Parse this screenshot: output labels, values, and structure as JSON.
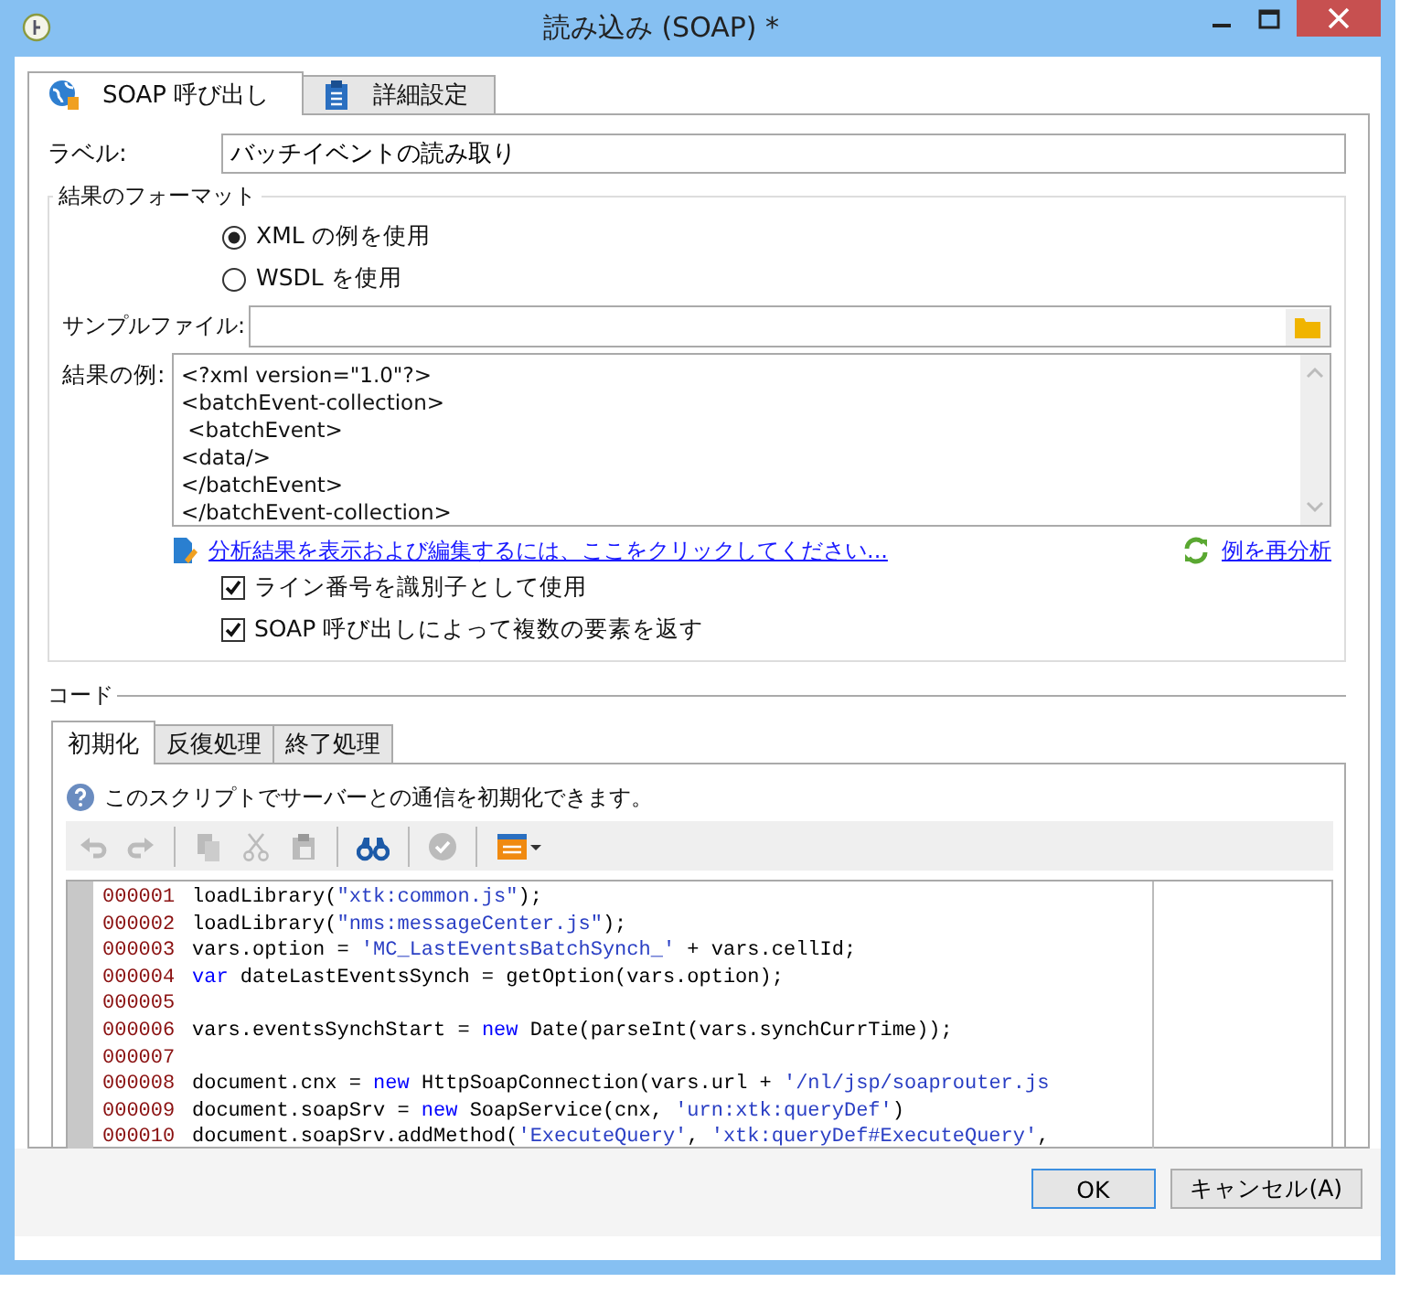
{
  "window": {
    "title": "読み込み (SOAP) *"
  },
  "tabs": [
    {
      "label": "SOAP 呼び出し",
      "selected": true
    },
    {
      "label": "詳細設定",
      "selected": false
    }
  ],
  "label_field": {
    "label": "ラベル:",
    "value": "バッチイベントの読み取り"
  },
  "result_format": {
    "title": "結果のフォーマット",
    "options": [
      {
        "label": "XML の例を使用",
        "selected": true
      },
      {
        "label": "WSDL を使用",
        "selected": false
      }
    ],
    "sample_file": {
      "label": "サンプルファイル:"
    },
    "example": {
      "label": "結果の例:",
      "lines": [
        "<?xml version=\"1.0\"?>",
        "<batchEvent-collection>",
        " <batchEvent>",
        "<data/>",
        "</batchEvent>",
        "</batchEvent-collection>"
      ]
    },
    "edit_link": "分析結果を表示および編集するには、ここをクリックしてください...",
    "reanalyze_link": "例を再分析",
    "checkboxes": [
      {
        "label": "ライン番号を識別子として使用",
        "checked": true
      },
      {
        "label": "SOAP 呼び出しによって複数の要素を返す",
        "checked": true
      }
    ]
  },
  "code": {
    "title": "コード",
    "tabs": [
      {
        "label": "初期化",
        "selected": true
      },
      {
        "label": "反復処理",
        "selected": false
      },
      {
        "label": "終了処理",
        "selected": false
      }
    ],
    "info": "このスクリプトでサーバーとの通信を初期化できます。",
    "toolbar": [
      {
        "kind": "undo",
        "disabled": true
      },
      {
        "kind": "redo",
        "disabled": true
      },
      {
        "kind": "sep"
      },
      {
        "kind": "copy",
        "disabled": true
      },
      {
        "kind": "cut",
        "disabled": true
      },
      {
        "kind": "paste",
        "disabled": true
      },
      {
        "kind": "sep"
      },
      {
        "kind": "find",
        "disabled": false
      },
      {
        "kind": "sep"
      },
      {
        "kind": "check",
        "disabled": true
      },
      {
        "kind": "sep"
      },
      {
        "kind": "insert",
        "disabled": false
      }
    ],
    "lines": [
      {
        "number": "000001",
        "tokens": [
          {
            "kind": "plain",
            "text": "loadLibrary("
          },
          {
            "kind": "string",
            "text": "\"xtk:common.js\""
          },
          {
            "kind": "plain",
            "text": ");"
          }
        ]
      },
      {
        "number": "000002",
        "tokens": [
          {
            "kind": "plain",
            "text": "loadLibrary("
          },
          {
            "kind": "string",
            "text": "\"nms:messageCenter.js\""
          },
          {
            "kind": "plain",
            "text": ");"
          }
        ]
      },
      {
        "number": "000003",
        "tokens": [
          {
            "kind": "plain",
            "text": "vars.option = "
          },
          {
            "kind": "string",
            "text": "'MC_LastEventsBatchSynch_'"
          },
          {
            "kind": "plain",
            "text": " + vars.cellId;"
          }
        ]
      },
      {
        "number": "000004",
        "tokens": [
          {
            "kind": "keyword",
            "text": "var"
          },
          {
            "kind": "plain",
            "text": " dateLastEventsSynch = getOption(vars.option);"
          }
        ]
      },
      {
        "number": "000005"
      },
      {
        "number": "000006",
        "tokens": [
          {
            "kind": "plain",
            "text": "vars.eventsSynchStart = "
          },
          {
            "kind": "keyword",
            "text": "new"
          },
          {
            "kind": "plain",
            "text": " Date(parseInt(vars.synchCurrTime));"
          }
        ]
      },
      {
        "number": "000007"
      },
      {
        "number": "000008",
        "tokens": [
          {
            "kind": "plain",
            "text": "document.cnx = "
          },
          {
            "kind": "keyword",
            "text": "new"
          },
          {
            "kind": "plain",
            "text": " HttpSoapConnection(vars.url + "
          },
          {
            "kind": "string",
            "text": "'/nl/jsp/soaprouter.js"
          }
        ]
      },
      {
        "number": "000009",
        "tokens": [
          {
            "kind": "plain",
            "text": "document.soapSrv = "
          },
          {
            "kind": "keyword",
            "text": "new"
          },
          {
            "kind": "plain",
            "text": " SoapService(cnx, "
          },
          {
            "kind": "string",
            "text": "'urn:xtk:queryDef'"
          },
          {
            "kind": "plain",
            "text": ")"
          }
        ]
      },
      {
        "number": "000010",
        "tokens": [
          {
            "kind": "plain",
            "text": "document.soapSrv.addMethod("
          },
          {
            "kind": "string",
            "text": "'ExecuteQuery'"
          },
          {
            "kind": "plain",
            "text": ", "
          },
          {
            "kind": "string",
            "text": "'xtk:queryDef#ExecuteQuery'"
          },
          {
            "kind": "plain",
            "text": ","
          }
        ]
      }
    ]
  },
  "buttons": [
    {
      "label": "OK",
      "default": true
    },
    {
      "label": "キャンセル(A)",
      "default": false
    }
  ]
}
